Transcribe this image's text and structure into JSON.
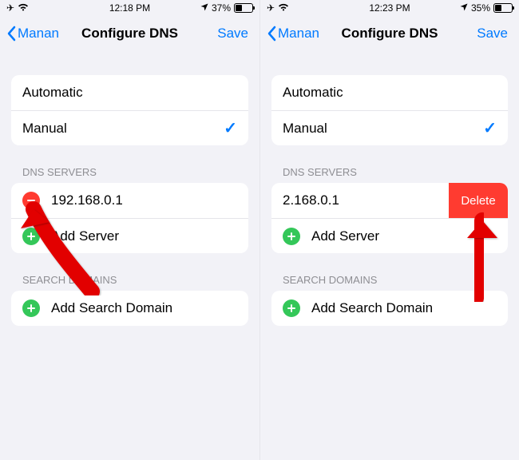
{
  "left": {
    "status": {
      "time": "12:18 PM",
      "battery": "37%"
    },
    "nav": {
      "back": "Manan",
      "title": "Configure DNS",
      "save": "Save"
    },
    "mode": {
      "automatic": "Automatic",
      "manual": "Manual"
    },
    "dns": {
      "header": "DNS SERVERS",
      "server0": "192.168.0.1",
      "add": "Add Server"
    },
    "search": {
      "header": "SEARCH DOMAINS",
      "add": "Add Search Domain"
    }
  },
  "right": {
    "status": {
      "time": "12:23 PM",
      "battery": "35%"
    },
    "nav": {
      "back": "Manan",
      "title": "Configure DNS",
      "save": "Save"
    },
    "mode": {
      "automatic": "Automatic",
      "manual": "Manual"
    },
    "dns": {
      "header": "DNS SERVERS",
      "server0": "2.168.0.1",
      "delete": "Delete",
      "add": "Add Server"
    },
    "search": {
      "header": "SEARCH DOMAINS",
      "add": "Add Search Domain"
    }
  }
}
